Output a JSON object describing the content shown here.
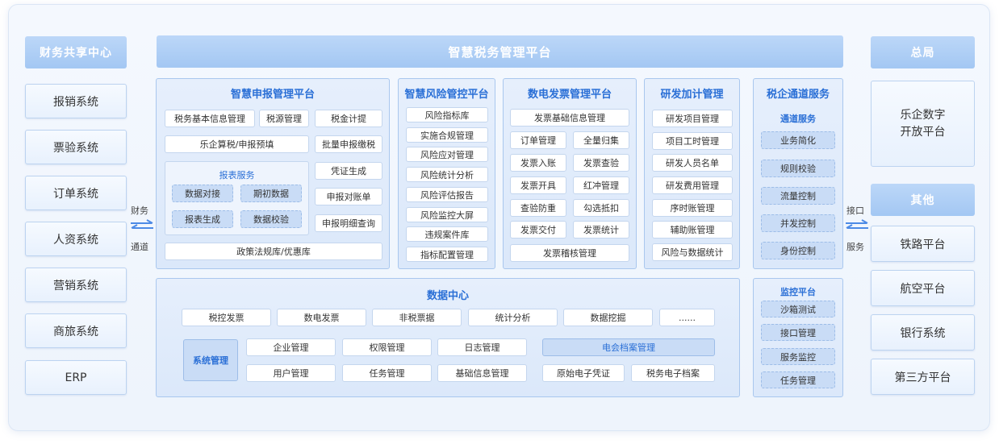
{
  "left": {
    "header": "财务共享中心",
    "systems": [
      "报销系统",
      "票验系统",
      "订单系统",
      "人资系统",
      "营销系统",
      "商旅系统",
      "ERP"
    ],
    "connector": {
      "top": "财务",
      "bottom": "通道"
    }
  },
  "top_banner": "智慧税务管理平台",
  "declaration": {
    "title": "智慧申报管理平台",
    "row1": [
      "税务基本信息管理",
      "税源管理",
      "税金计提"
    ],
    "row2": [
      "乐企算税/申报预填",
      "批量申报缴税"
    ],
    "report_service": {
      "title": "报表服务",
      "items": [
        "数据对接",
        "期初数据",
        "报表生成",
        "数据校验"
      ]
    },
    "right_col": [
      "凭证生成",
      "申报对账单",
      "申报明细查询"
    ],
    "bottom": "政策法规库/优惠库"
  },
  "risk": {
    "title": "智慧风险管控平台",
    "items": [
      "风险指标库",
      "实施合规管理",
      "风险应对管理",
      "风险统计分析",
      "风险评估报告",
      "风险监控大屏",
      "违规案件库",
      "指标配置管理"
    ]
  },
  "invoice": {
    "title": "数电发票管理平台",
    "top": "发票基础信息管理",
    "grid": [
      "订单管理",
      "全量归集",
      "发票入账",
      "发票查验",
      "发票开具",
      "红冲管理",
      "查验防重",
      "勾选抵扣",
      "发票交付",
      "发票统计"
    ],
    "bottom": "发票稽核管理"
  },
  "rd": {
    "title": "研发加计管理",
    "items": [
      "研发项目管理",
      "项目工时管理",
      "研发人员名单",
      "研发费用管理",
      "序时账管理",
      "辅助账管理",
      "风险与数据统计"
    ]
  },
  "channel": {
    "title": "税企通道服务",
    "subtitle": "通道服务",
    "items": [
      "业务简化",
      "规则校验",
      "流量控制",
      "并发控制",
      "身份控制"
    ]
  },
  "monitor": {
    "title": "监控平台",
    "items": [
      "沙箱测试",
      "接口管理",
      "服务监控",
      "任务管理"
    ]
  },
  "data_center": {
    "title": "数据中心",
    "row1": [
      "税控发票",
      "数电发票",
      "非税票据",
      "统计分析",
      "数据挖掘",
      "......"
    ],
    "sys_mgmt": "系统管理",
    "mgmt_row1": [
      "企业管理",
      "权限管理",
      "日志管理"
    ],
    "mgmt_row2": [
      "用户管理",
      "任务管理",
      "基础信息管理"
    ],
    "archive": {
      "title": "电会档案管理",
      "items": [
        "原始电子凭证",
        "税务电子档案"
      ]
    }
  },
  "right": {
    "header": "总局",
    "open_platform": {
      "line1": "乐企数字",
      "line2": "开放平台"
    },
    "other_header": "其他",
    "systems": [
      "铁路平台",
      "航空平台",
      "银行系统",
      "第三方平台"
    ],
    "connector": {
      "top": "接口",
      "bottom": "服务"
    }
  }
}
